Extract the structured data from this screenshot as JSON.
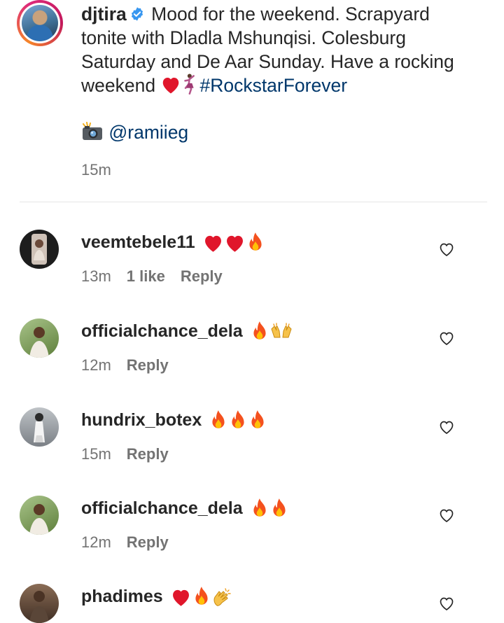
{
  "caption": {
    "username": "djtira",
    "text_part1": "Mood for the weekend. Scrapyard tonite with Dladla Mshunqisi. Colesburg Saturday and De Aar Sunday. Have a rocking weekend ",
    "hashtag": "#RockstarForever",
    "mention": "@ramiieg",
    "time": "15m",
    "verified_color": "#3897f0"
  },
  "comments": [
    {
      "username": "veemtebele11",
      "emojis": [
        "red-heart",
        "red-heart",
        "fire"
      ],
      "time": "13m",
      "likes": "1 like",
      "reply": "Reply"
    },
    {
      "username": "officialchance_dela",
      "emojis": [
        "fire",
        "raising-hands"
      ],
      "time": "12m",
      "likes": "",
      "reply": "Reply"
    },
    {
      "username": "hundrix_botex",
      "emojis": [
        "fire",
        "fire",
        "fire"
      ],
      "time": "15m",
      "likes": "",
      "reply": "Reply"
    },
    {
      "username": "officialchance_dela",
      "emojis": [
        "fire",
        "fire"
      ],
      "time": "12m",
      "likes": "",
      "reply": "Reply"
    },
    {
      "username": "phadimes",
      "emojis": [
        "red-heart",
        "fire",
        "clapping-hands"
      ],
      "time": "",
      "likes": "",
      "reply": ""
    }
  ],
  "colors": {
    "text": "#262626",
    "secondary": "#737373",
    "link": "#00376b"
  }
}
